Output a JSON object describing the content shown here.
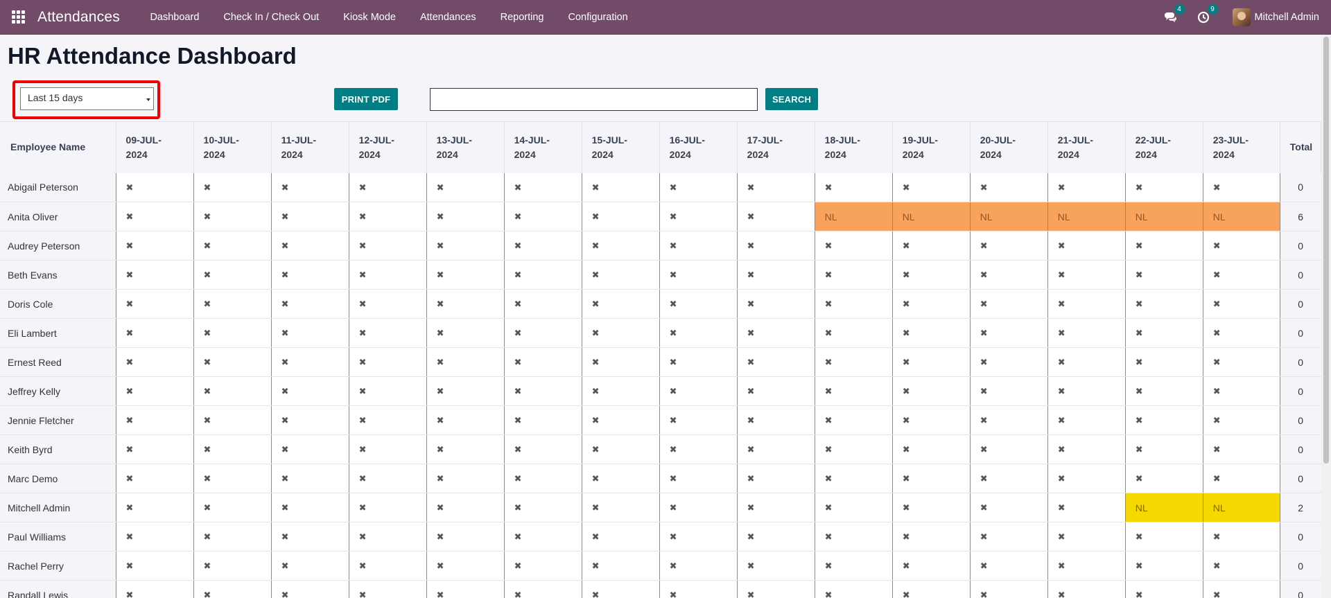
{
  "navbar": {
    "app_name": "Attendances",
    "menu": [
      "Dashboard",
      "Check In / Check Out",
      "Kiosk Mode",
      "Attendances",
      "Reporting",
      "Configuration"
    ],
    "messages_badge": "4",
    "activities_badge": "9",
    "user_name": "Mitchell Admin"
  },
  "page": {
    "title": "HR Attendance Dashboard"
  },
  "controls": {
    "period_selected": "Last 15 days",
    "print_label": "PRINT PDF",
    "search_value": "",
    "search_label": "SEARCH"
  },
  "table": {
    "employee_header": "Employee Name",
    "total_header": "Total",
    "dates": [
      [
        "09-JUL-",
        "2024"
      ],
      [
        "10-JUL-",
        "2024"
      ],
      [
        "11-JUL-",
        "2024"
      ],
      [
        "12-JUL-",
        "2024"
      ],
      [
        "13-JUL-",
        "2024"
      ],
      [
        "14-JUL-",
        "2024"
      ],
      [
        "15-JUL-",
        "2024"
      ],
      [
        "16-JUL-",
        "2024"
      ],
      [
        "17-JUL-",
        "2024"
      ],
      [
        "18-JUL-",
        "2024"
      ],
      [
        "19-JUL-",
        "2024"
      ],
      [
        "20-JUL-",
        "2024"
      ],
      [
        "21-JUL-",
        "2024"
      ],
      [
        "22-JUL-",
        "2024"
      ],
      [
        "23-JUL-",
        "2024"
      ]
    ],
    "absent_mark": "✖",
    "leave_mark": "NL",
    "colors": {
      "orange_leave": "#f7a35c",
      "yellow_leave": "#f5d800"
    },
    "rows": [
      {
        "name": "Abigail Peterson",
        "cells": [
          "x",
          "x",
          "x",
          "x",
          "x",
          "x",
          "x",
          "x",
          "x",
          "x",
          "x",
          "x",
          "x",
          "x",
          "x"
        ],
        "total": "0"
      },
      {
        "name": "Anita Oliver",
        "cells": [
          "x",
          "x",
          "x",
          "x",
          "x",
          "x",
          "x",
          "x",
          "x",
          "NL-orange",
          "NL-orange",
          "NL-orange",
          "NL-orange",
          "NL-orange",
          "NL-orange"
        ],
        "total": "6"
      },
      {
        "name": "Audrey Peterson",
        "cells": [
          "x",
          "x",
          "x",
          "x",
          "x",
          "x",
          "x",
          "x",
          "x",
          "x",
          "x",
          "x",
          "x",
          "x",
          "x"
        ],
        "total": "0"
      },
      {
        "name": "Beth Evans",
        "cells": [
          "x",
          "x",
          "x",
          "x",
          "x",
          "x",
          "x",
          "x",
          "x",
          "x",
          "x",
          "x",
          "x",
          "x",
          "x"
        ],
        "total": "0"
      },
      {
        "name": "Doris Cole",
        "cells": [
          "x",
          "x",
          "x",
          "x",
          "x",
          "x",
          "x",
          "x",
          "x",
          "x",
          "x",
          "x",
          "x",
          "x",
          "x"
        ],
        "total": "0"
      },
      {
        "name": "Eli Lambert",
        "cells": [
          "x",
          "x",
          "x",
          "x",
          "x",
          "x",
          "x",
          "x",
          "x",
          "x",
          "x",
          "x",
          "x",
          "x",
          "x"
        ],
        "total": "0"
      },
      {
        "name": "Ernest Reed",
        "cells": [
          "x",
          "x",
          "x",
          "x",
          "x",
          "x",
          "x",
          "x",
          "x",
          "x",
          "x",
          "x",
          "x",
          "x",
          "x"
        ],
        "total": "0"
      },
      {
        "name": "Jeffrey Kelly",
        "cells": [
          "x",
          "x",
          "x",
          "x",
          "x",
          "x",
          "x",
          "x",
          "x",
          "x",
          "x",
          "x",
          "x",
          "x",
          "x"
        ],
        "total": "0"
      },
      {
        "name": "Jennie Fletcher",
        "cells": [
          "x",
          "x",
          "x",
          "x",
          "x",
          "x",
          "x",
          "x",
          "x",
          "x",
          "x",
          "x",
          "x",
          "x",
          "x"
        ],
        "total": "0"
      },
      {
        "name": "Keith Byrd",
        "cells": [
          "x",
          "x",
          "x",
          "x",
          "x",
          "x",
          "x",
          "x",
          "x",
          "x",
          "x",
          "x",
          "x",
          "x",
          "x"
        ],
        "total": "0"
      },
      {
        "name": "Marc Demo",
        "cells": [
          "x",
          "x",
          "x",
          "x",
          "x",
          "x",
          "x",
          "x",
          "x",
          "x",
          "x",
          "x",
          "x",
          "x",
          "x"
        ],
        "total": "0"
      },
      {
        "name": "Mitchell Admin",
        "cells": [
          "x",
          "x",
          "x",
          "x",
          "x",
          "x",
          "x",
          "x",
          "x",
          "x",
          "x",
          "x",
          "x",
          "NL-yellow",
          "NL-yellow"
        ],
        "total": "2"
      },
      {
        "name": "Paul Williams",
        "cells": [
          "x",
          "x",
          "x",
          "x",
          "x",
          "x",
          "x",
          "x",
          "x",
          "x",
          "x",
          "x",
          "x",
          "x",
          "x"
        ],
        "total": "0"
      },
      {
        "name": "Rachel Perry",
        "cells": [
          "x",
          "x",
          "x",
          "x",
          "x",
          "x",
          "x",
          "x",
          "x",
          "x",
          "x",
          "x",
          "x",
          "x",
          "x"
        ],
        "total": "0"
      },
      {
        "name": "Randall Lewis",
        "cells": [
          "x",
          "x",
          "x",
          "x",
          "x",
          "x",
          "x",
          "x",
          "x",
          "x",
          "x",
          "x",
          "x",
          "x",
          "x"
        ],
        "total": "0"
      }
    ]
  }
}
